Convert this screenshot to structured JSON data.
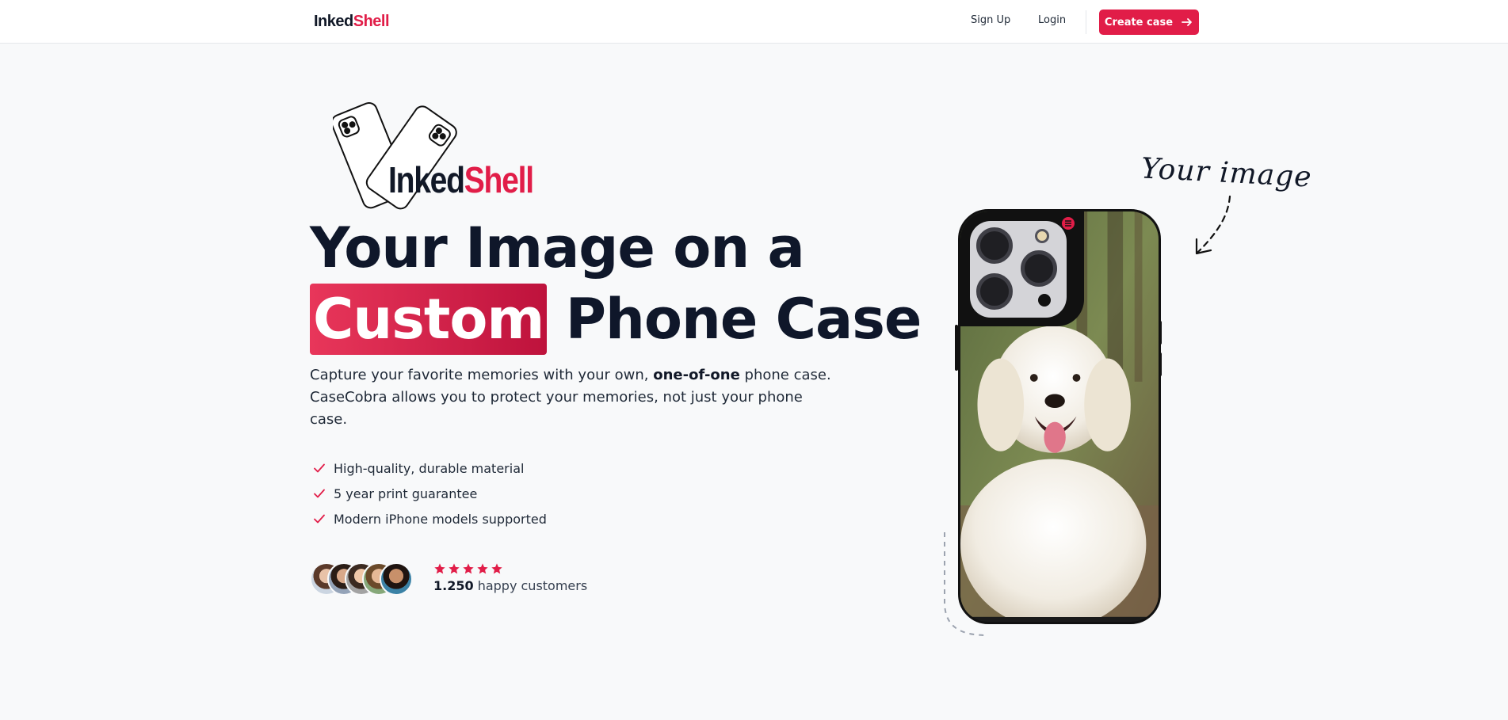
{
  "nav": {
    "logo_a": "Inked",
    "logo_b": "Shell",
    "signup": "Sign Up",
    "login": "Login",
    "cta": "Create case",
    "cta_icon": "arrow-right-icon"
  },
  "hero": {
    "logo_a": "Inked",
    "logo_b": "Shell",
    "headline_1": "Your Image on a",
    "headline_highlight": "Custom",
    "headline_2": "Phone Case",
    "desc_1": "Capture your favorite memories with your own, ",
    "desc_bold": "one-of-one",
    "desc_2": " phone case. CaseCobra allows you to protect your memories, not just your phone case.",
    "features": [
      "High-quality, durable material",
      "5 year print guarantee",
      "Modern iPhone models supported"
    ],
    "rating_stars": 5,
    "customers_count": "1.250",
    "customers_label": " happy customers"
  },
  "showcase": {
    "annotation": "Your image"
  },
  "colors": {
    "accent": "#e11d48",
    "text": "#0f172a",
    "background": "#f8f9fa"
  }
}
